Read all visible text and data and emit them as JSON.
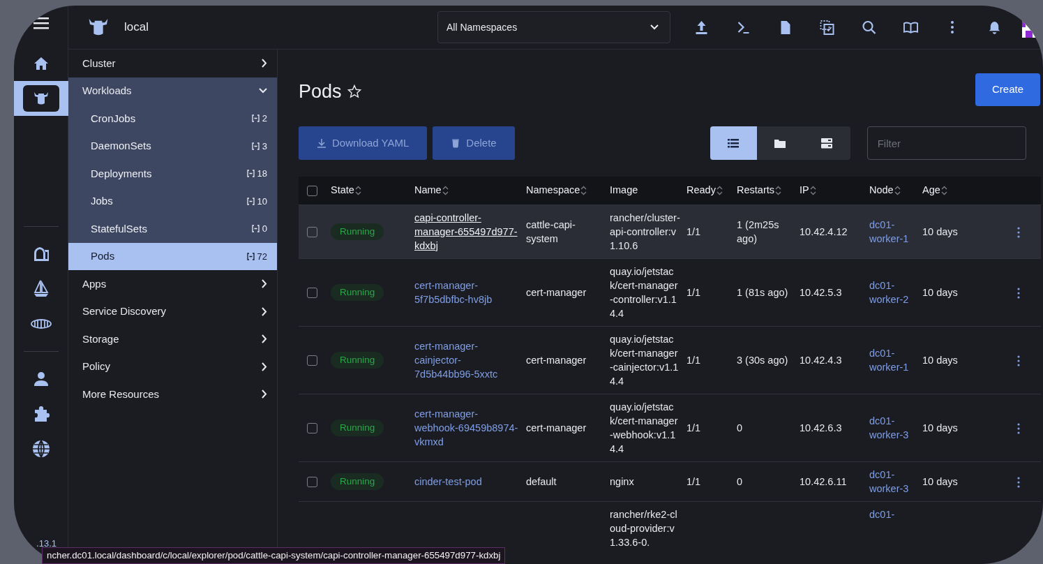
{
  "header": {
    "cluster": "local",
    "namespace_select": "All Namespaces"
  },
  "version": ".13.1",
  "sidebar": {
    "items": [
      {
        "label": "Cluster",
        "expanded": false
      },
      {
        "label": "Workloads",
        "expanded": true,
        "children": [
          {
            "label": "CronJobs",
            "count": "2",
            "selected": false
          },
          {
            "label": "DaemonSets",
            "count": "3",
            "selected": false
          },
          {
            "label": "Deployments",
            "count": "18",
            "selected": false
          },
          {
            "label": "Jobs",
            "count": "10",
            "selected": false
          },
          {
            "label": "StatefulSets",
            "count": "0",
            "selected": false
          },
          {
            "label": "Pods",
            "count": "72",
            "selected": true
          }
        ]
      },
      {
        "label": "Apps",
        "expanded": false
      },
      {
        "label": "Service Discovery",
        "expanded": false
      },
      {
        "label": "Storage",
        "expanded": false
      },
      {
        "label": "Policy",
        "expanded": false
      },
      {
        "label": "More Resources",
        "expanded": false
      }
    ]
  },
  "page": {
    "title": "Pods",
    "favorite": false,
    "create": "Create",
    "actions": [
      {
        "label": "Download YAML",
        "kind": "download",
        "disabled": true
      },
      {
        "label": "Delete",
        "kind": "delete",
        "disabled": true
      }
    ],
    "views": [
      {
        "kind": "list",
        "selected": true
      },
      {
        "kind": "folder",
        "selected": false
      },
      {
        "kind": "group",
        "selected": false
      }
    ],
    "filter": {
      "placeholder": "Filter"
    }
  },
  "table": {
    "columns": [
      {
        "label": "State",
        "sortable": true
      },
      {
        "label": "Name",
        "sortable": true
      },
      {
        "label": "Namespace",
        "sortable": true
      },
      {
        "label": "Image",
        "sortable": false
      },
      {
        "label": "Ready",
        "sortable": true
      },
      {
        "label": "Restarts",
        "sortable": true
      },
      {
        "label": "IP",
        "sortable": true
      },
      {
        "label": "Node",
        "sortable": true
      },
      {
        "label": "Age",
        "sortable": true
      }
    ],
    "rows": [
      {
        "checked": false,
        "hovered": true,
        "state": "Running",
        "name": "capi-controller-manager-655497d977-kdxbj",
        "namespace": "cattle-capi-system",
        "image": "rancher/cluster-api-controller:v1.10.6",
        "ready": "1/1",
        "restarts": "1 (2m25s ago)",
        "ip": "10.42.4.12",
        "node": "dc01-worker-1",
        "age": "10 days"
      },
      {
        "checked": false,
        "hovered": false,
        "state": "Running",
        "name": "cert-manager-5f7b5dbfbc-hv8jb",
        "namespace": "cert-manager",
        "image": "quay.io/jetstack/cert-manager-controller:v1.14.4",
        "ready": "1/1",
        "restarts": "1 (81s ago)",
        "ip": "10.42.5.3",
        "node": "dc01-worker-2",
        "age": "10 days"
      },
      {
        "checked": false,
        "hovered": false,
        "state": "Running",
        "name": "cert-manager-cainjector-7d5b44bb96-5xxtc",
        "namespace": "cert-manager",
        "image": "quay.io/jetstack/cert-manager-cainjector:v1.14.4",
        "ready": "1/1",
        "restarts": "3 (30s ago)",
        "ip": "10.42.4.3",
        "node": "dc01-worker-1",
        "age": "10 days"
      },
      {
        "checked": false,
        "hovered": false,
        "state": "Running",
        "name": "cert-manager-webhook-69459b8974-vkmxd",
        "namespace": "cert-manager",
        "image": "quay.io/jetstack/cert-manager-webhook:v1.14.4",
        "ready": "1/1",
        "restarts": "0",
        "ip": "10.42.6.3",
        "node": "dc01-worker-3",
        "age": "10 days"
      },
      {
        "checked": false,
        "hovered": false,
        "state": "Running",
        "name": "cinder-test-pod",
        "namespace": "default",
        "image": "nginx",
        "ready": "1/1",
        "restarts": "0",
        "ip": "10.42.6.11",
        "node": "dc01-worker-3",
        "age": "10 days"
      },
      {
        "image": "rancher/rke2-cloud-provider:v1.33.6-0.",
        "node": "dc01-"
      }
    ],
    "select_all_checked": false
  },
  "status_url": "ncher.dc01.local/dashboard/c/local/explorer/pod/cattle-capi-system/capi-controller-manager-655497d977-kdxbj"
}
